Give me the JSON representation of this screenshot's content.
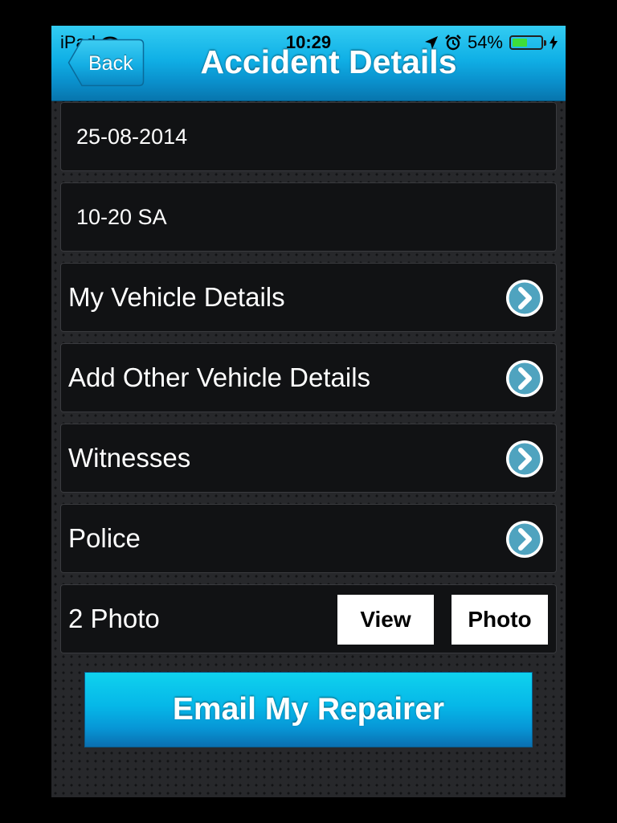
{
  "status_bar": {
    "device": "iPad",
    "time": "10:29",
    "battery_percent": "54%",
    "battery_level": 0.54,
    "icons": [
      "wifi-icon",
      "location-arrow-icon",
      "alarm-icon",
      "battery-icon",
      "charging-bolt-icon"
    ]
  },
  "nav": {
    "back_label": "Back",
    "title": "Accident Details"
  },
  "fields": {
    "date_value": "25-08-2014",
    "time_value": "10-20 SA"
  },
  "menu": {
    "items": [
      {
        "label": "My Vehicle Details",
        "icon": "chevron-right-icon"
      },
      {
        "label": "Add Other Vehicle Details",
        "icon": "chevron-right-icon"
      },
      {
        "label": "Witnesses",
        "icon": "chevron-right-icon"
      },
      {
        "label": "Police",
        "icon": "chevron-right-icon"
      }
    ]
  },
  "photos": {
    "count_label": "2 Photo",
    "view_button": "View",
    "photo_button": "Photo"
  },
  "email_button": "Email My Repairer",
  "colors": {
    "nav_blue": "#10b0e6",
    "row_background": "#111214",
    "chevron_teal": "#4fa3bf",
    "battery_green": "#3ede3a",
    "page_background": "#27282b"
  }
}
